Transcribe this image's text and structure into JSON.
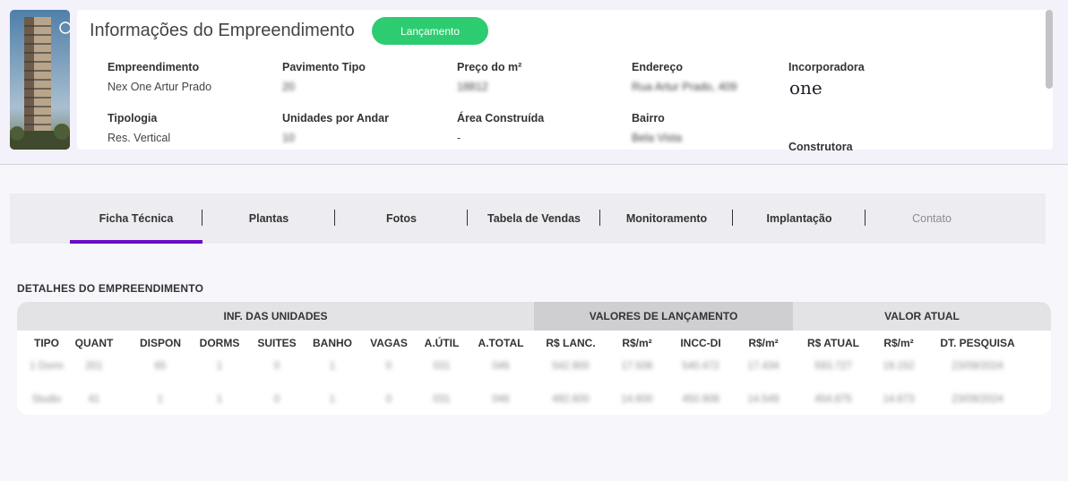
{
  "header": {
    "title": "Informações do Empreendimento",
    "badge": "Lançamento"
  },
  "fields": {
    "empreendimento": {
      "label": "Empreendimento",
      "value": "Nex One Artur Prado"
    },
    "tipologia": {
      "label": "Tipologia",
      "value": "Res. Vertical"
    },
    "pavimento": {
      "label": "Pavimento Tipo",
      "value": "20"
    },
    "unidades": {
      "label": "Unidades por Andar",
      "value": "10"
    },
    "preco": {
      "label": "Preço do m²",
      "value": "18812"
    },
    "area": {
      "label": "Área Construída",
      "value": "-"
    },
    "endereco": {
      "label": "Endereço",
      "value": "Rua Artur Prado, 409"
    },
    "bairro": {
      "label": "Bairro",
      "value": "Bela Vista"
    },
    "incorporadora": {
      "label": "Incorporadora",
      "logo_text": "one"
    },
    "construtora": {
      "label": "Construtora"
    }
  },
  "tabs": [
    "Ficha Técnica",
    "Plantas",
    "Fotos",
    "Tabela de Vendas",
    "Monitoramento",
    "Implantação",
    "Contato"
  ],
  "details": {
    "section_title": "DETALHES DO EMPREENDIMENTO",
    "groups": [
      "INF. DAS UNIDADES",
      "VALORES DE LANÇAMENTO",
      "VALOR ATUAL"
    ],
    "columns": [
      "TIPO",
      "QUANT",
      "DISPON",
      "DORMS",
      "SUITES",
      "BANHO",
      "VAGAS",
      "A.ÚTIL",
      "A.TOTAL",
      "R$ LANC.",
      "R$/m²",
      "INCC-DI",
      "R$/m²",
      "R$ ATUAL",
      "R$/m²",
      "DT. PESQUISA"
    ],
    "rows": [
      [
        "1 Dorm",
        "201",
        "65",
        "1",
        "0",
        "1",
        "0",
        "031",
        "046",
        "542.900",
        "17.506",
        "540.472",
        "17.434",
        "593.727",
        "19.152",
        "23/09/2024"
      ],
      [
        "Studio",
        "41",
        "1",
        "1",
        "0",
        "1",
        "0",
        "031",
        "046",
        "492.600",
        "14.600",
        "450.908",
        "14.549",
        "454.875",
        "14.673",
        "23/09/2024"
      ]
    ]
  },
  "colors": {
    "accent": "#6b0ac9",
    "badge": "#2ecc71"
  }
}
